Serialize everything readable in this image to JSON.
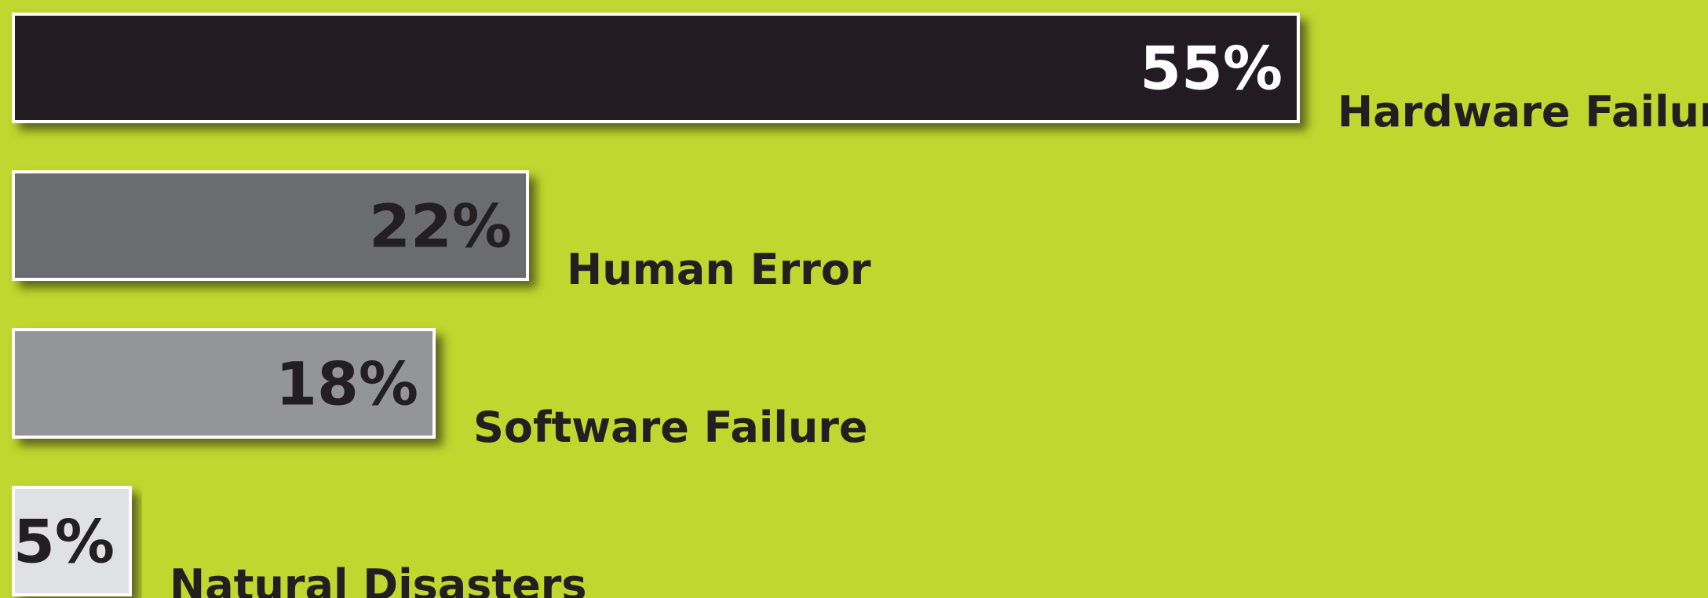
{
  "colors": {
    "background": "#c0d730",
    "bar_border": "#ffffff",
    "label_text": "#231f20"
  },
  "chart_data": {
    "type": "bar",
    "orientation": "horizontal",
    "categories": [
      "Hardware Failure",
      "Human Error",
      "Software Failure",
      "Natural Disasters"
    ],
    "values": [
      55,
      22,
      18,
      5
    ],
    "value_labels": [
      "55%",
      "22%",
      "18%",
      "5%"
    ],
    "unit": "%",
    "bar_colors": [
      "#231f20",
      "#6b6c70",
      "#939598",
      "#e0e1e2"
    ],
    "value_label_colors": [
      "#ffffff",
      "#231f20",
      "#231f20",
      "#231f20"
    ],
    "grid": false,
    "legend": "none"
  }
}
